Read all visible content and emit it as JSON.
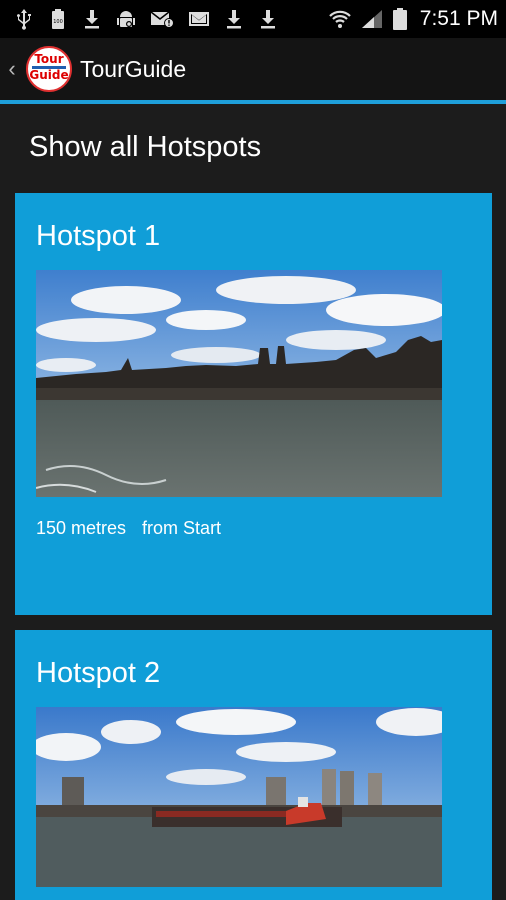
{
  "status_bar": {
    "icons": [
      "usb-icon",
      "battery-100-icon",
      "download-icon",
      "android-debug-icon",
      "mail-alert-icon",
      "gmail-icon",
      "download-icon",
      "download-icon"
    ],
    "right_icons": [
      "wifi-icon",
      "signal-icon",
      "battery-icon"
    ],
    "time": "7:51 PM"
  },
  "action_bar": {
    "logo_line1": "Tour",
    "logo_line2": "Guide",
    "title": "TourGuide"
  },
  "main": {
    "section_title": "Show all Hotspots",
    "hotspots": [
      {
        "title": "Hotspot 1",
        "distance_value": "150 metres",
        "distance_suffix": "from Start"
      },
      {
        "title": "Hotspot 2"
      }
    ]
  },
  "colors": {
    "accent": "#1e9fda",
    "card_background": "#109ed8",
    "background": "#1c1c1c"
  }
}
